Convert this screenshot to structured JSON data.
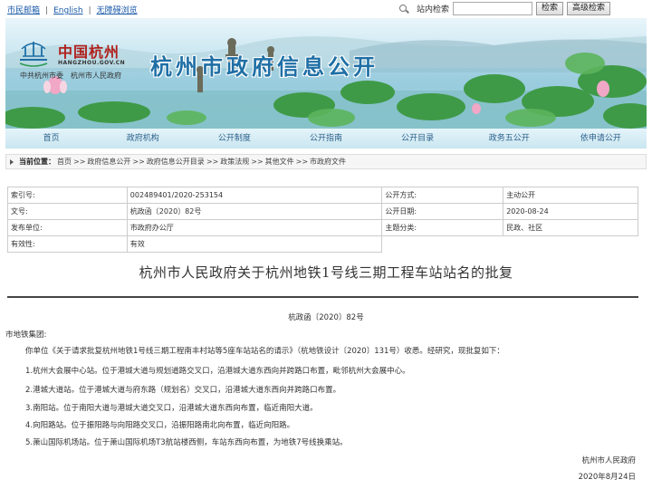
{
  "topbar": {
    "links": [
      "市民邮箱",
      "English",
      "无障碍浏览"
    ],
    "search_label": "站内检索",
    "search_placeholder": "",
    "search_button": "检索",
    "advanced_button": "高级检索"
  },
  "banner": {
    "logo_cn": "中国杭州",
    "logo_domain": "HANGZHOU.GOV.CN",
    "logo_sub_left": "中共杭州市委",
    "logo_sub_right": "杭州市人民政府",
    "title": "杭州市政府信息公开"
  },
  "nav": [
    "首页",
    "政府机构",
    "公开制度",
    "公开指南",
    "公开目录",
    "政务五公开",
    "依申请公开"
  ],
  "breadcrumb": {
    "label": "当前位置：",
    "items": [
      "首页",
      "政府信息公开",
      "政府信息公开目录",
      "政策法规",
      "其他文件",
      "市政府文件"
    ]
  },
  "info": {
    "rows": [
      {
        "k1": "索引号:",
        "v1": "002489401/2020-253154",
        "k2": "公开方式:",
        "v2": "主动公开"
      },
      {
        "k1": "文号:",
        "v1": "杭政函〔2020〕82号",
        "k2": "公开日期:",
        "v2": "2020-08-24"
      },
      {
        "k1": "发布单位:",
        "v1": "市政府办公厅",
        "k2": "主题分类:",
        "v2": "民政、社区"
      },
      {
        "k1": "有效性:",
        "v1": "有效",
        "k2": "",
        "v2": ""
      }
    ]
  },
  "document": {
    "title": "杭州市人民政府关于杭州地铁1号线三期工程车站站名的批复",
    "number": "杭政函〔2020〕82号",
    "addressee": "市地铁集团:",
    "paragraphs": [
      "你单位《关于请求批复杭州地铁1号线三期工程南丰村站等5座车站站名的请示》（杭地铁设计〔2020〕131号）收悉。经研究，现批复如下：",
      "1.杭州大会展中心站。位于港城大道与规划道路交叉口，沿港城大道东西向并跨路口布置，毗邻杭州大会展中心。",
      "2.港城大道站。位于港城大道与府东路（规划名）交叉口，沿港城大道东西向并跨路口布置。",
      "3.南阳站。位于南阳大道与港城大道交叉口，沿港城大道东西向布置，临近南阳大道。",
      "4.向阳路站。位于振阳路与向阳路交叉口，沿振阳路南北向布置，临近向阳路。",
      "5.萧山国际机场站。位于萧山国际机场T3航站楼西侧，车站东西向布置，为地铁7号线换乘站。"
    ],
    "signature": "杭州市人民政府",
    "date": "2020年8月24日"
  }
}
